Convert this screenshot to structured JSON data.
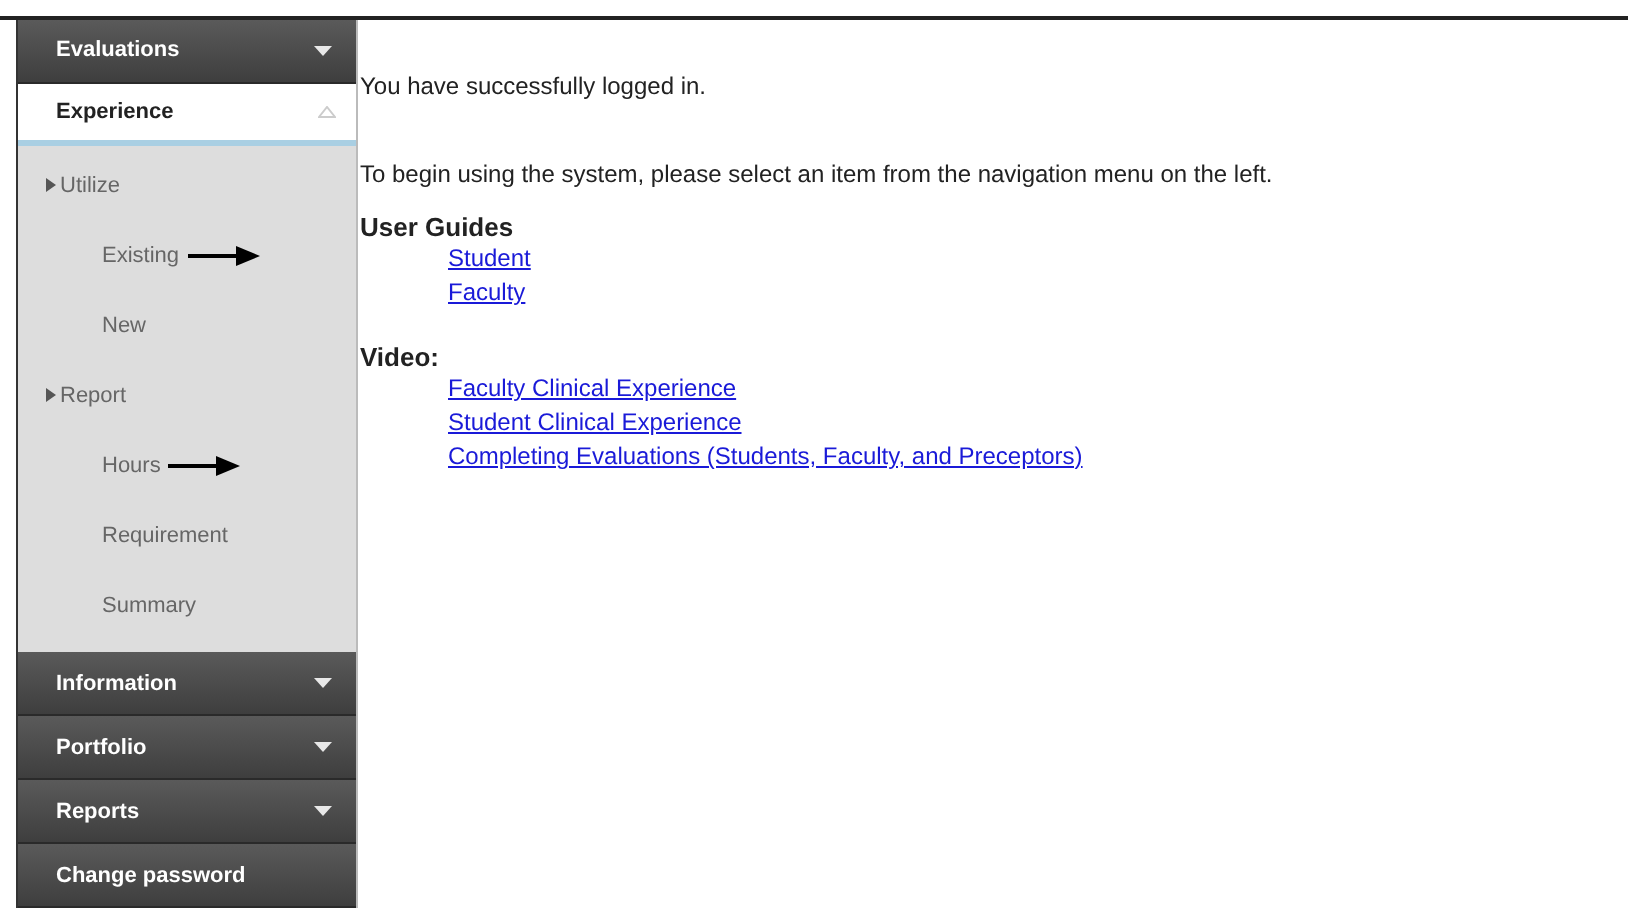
{
  "sidebar": {
    "top_section": {
      "label": "Evaluations",
      "expanded": false
    },
    "open_section": {
      "label": "Experience",
      "expanded": true,
      "items": [
        {
          "kind": "group",
          "label": "Utilize",
          "arrow": false
        },
        {
          "kind": "link",
          "label": "Existing",
          "arrow": true
        },
        {
          "kind": "link",
          "label": "New",
          "arrow": false
        },
        {
          "kind": "group",
          "label": "Report",
          "arrow": false
        },
        {
          "kind": "link",
          "label": "Hours",
          "arrow": true
        },
        {
          "kind": "link",
          "label": "Requirement",
          "arrow": false
        },
        {
          "kind": "link",
          "label": "Summary",
          "arrow": false
        }
      ]
    },
    "bottom_sections": [
      {
        "label": "Information",
        "expanded": false
      },
      {
        "label": "Portfolio",
        "expanded": false
      },
      {
        "label": "Reports",
        "expanded": false
      },
      {
        "label": "Change password"
      }
    ]
  },
  "main": {
    "message": "You have successfully logged in.",
    "instruction": "To begin using the system, please select an item from the navigation menu on the left.",
    "groups": [
      {
        "heading": "User Guides",
        "links": [
          "Student",
          "Faculty"
        ]
      },
      {
        "heading": "Video:",
        "links": [
          "Faculty Clinical Experience",
          "Student Clinical Experience",
          "Completing Evaluations (Students, Faculty, and Preceptors)"
        ]
      }
    ]
  }
}
